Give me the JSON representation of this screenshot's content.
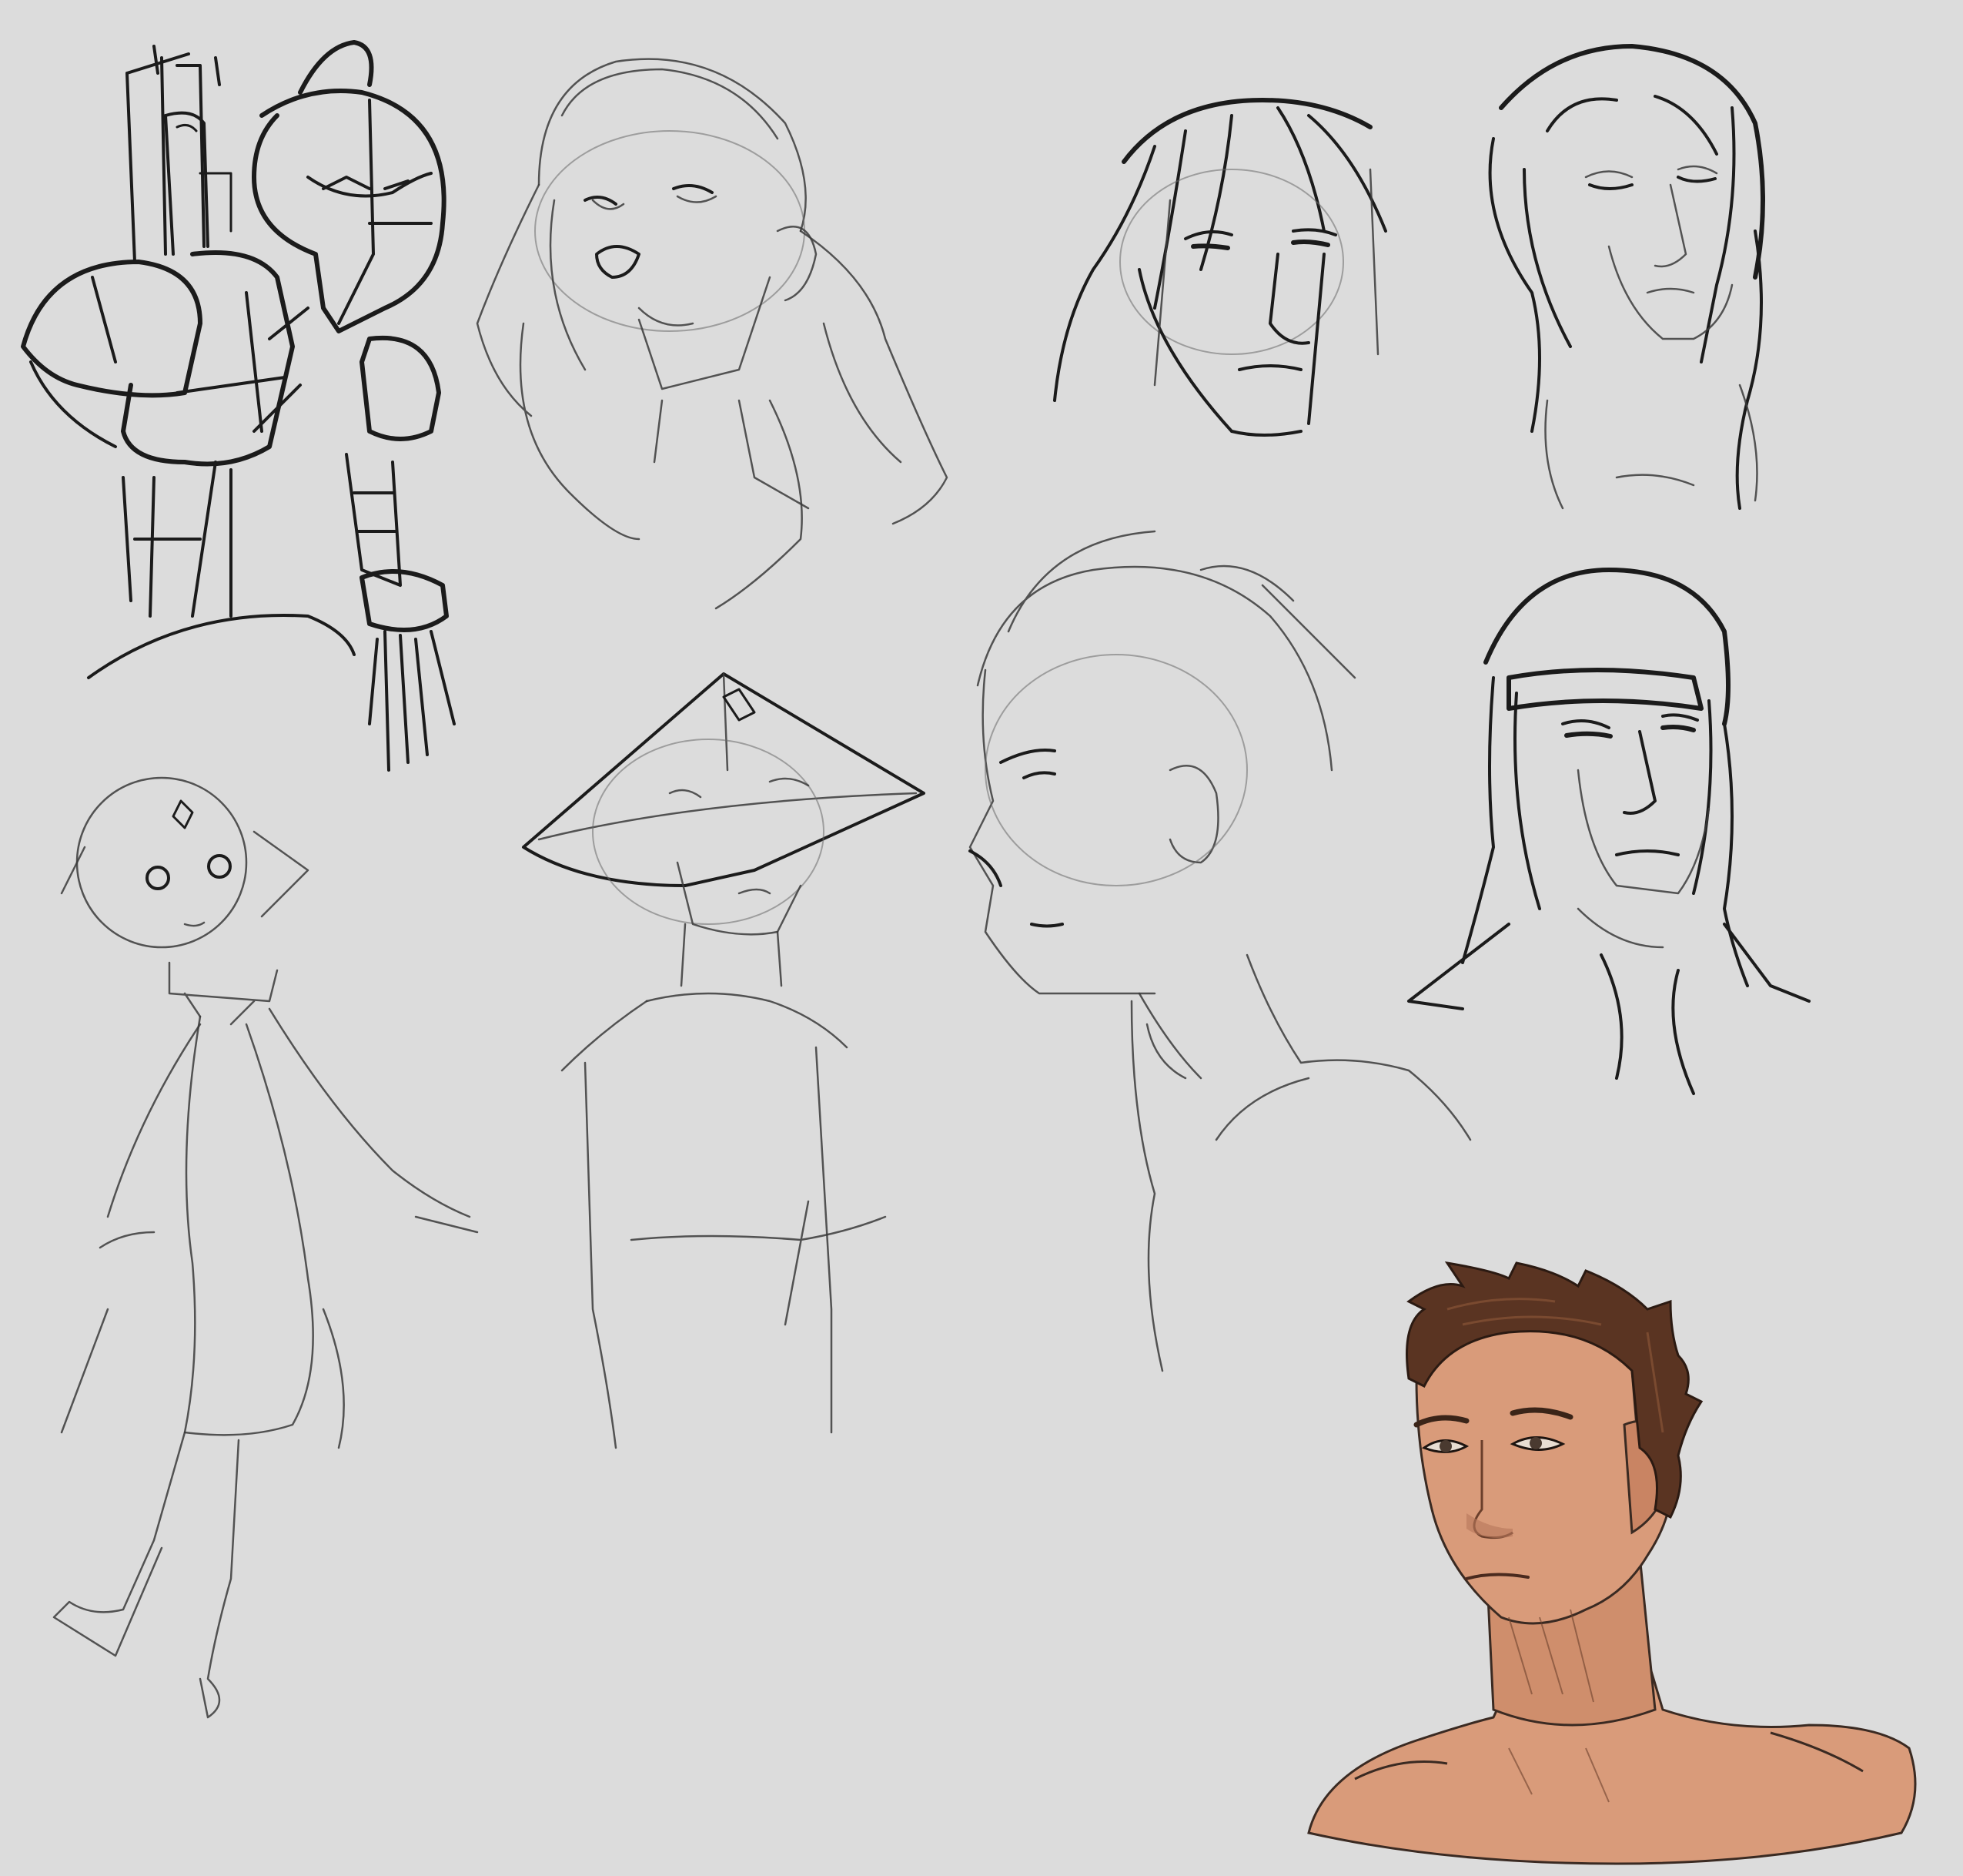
{
  "canvas": {
    "background": "#dcdcdc",
    "ink_color": "#1b1b1b",
    "skin_color": "#d99b7a",
    "hair_color": "#5a3422"
  },
  "sketches": [
    {
      "id": "armored-robot",
      "style": "ink"
    },
    {
      "id": "long-hair-smiling-head",
      "style": "pencil"
    },
    {
      "id": "messy-hair-head",
      "style": "ink"
    },
    {
      "id": "long-hair-upward-gaze-head",
      "style": "pencil"
    },
    {
      "id": "small-robe-figure",
      "style": "pencil"
    },
    {
      "id": "conical-hat-figure",
      "style": "pencil"
    },
    {
      "id": "profile-head",
      "style": "pencil"
    },
    {
      "id": "headband-head",
      "style": "pencil"
    },
    {
      "id": "colored-portrait",
      "style": "painted"
    }
  ]
}
